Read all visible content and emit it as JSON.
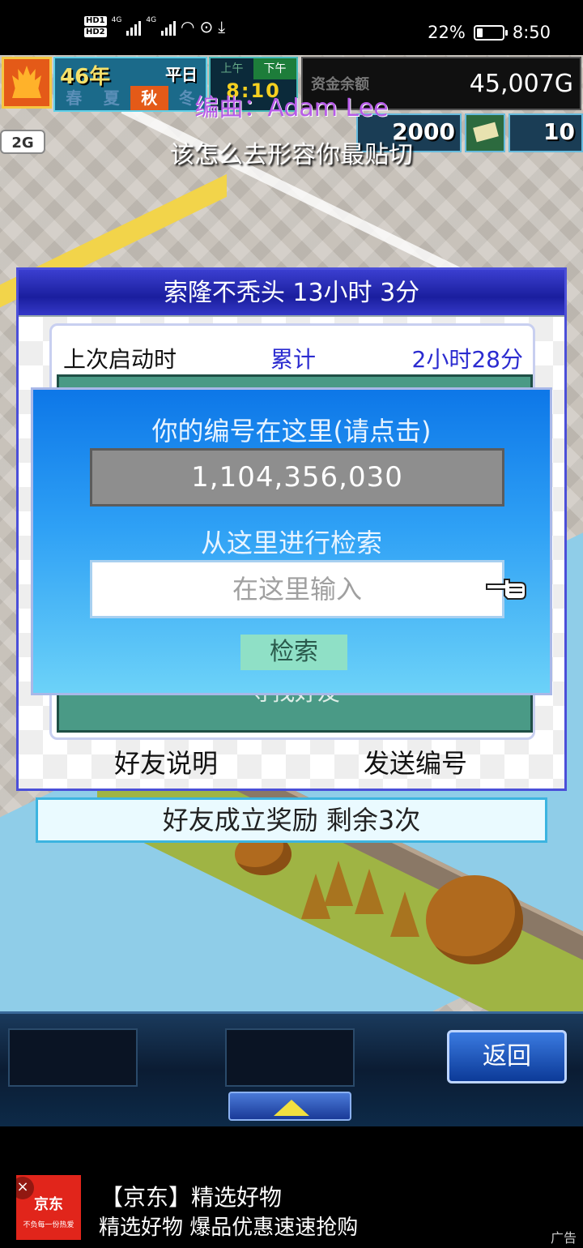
{
  "status_bar": {
    "hd1": "HD1",
    "hd2": "HD2",
    "net1": "4G",
    "net2": "4G",
    "battery": "22%",
    "battery_level": 0.22,
    "time": "8:50"
  },
  "hud": {
    "year": "46年",
    "day_type": "平日",
    "seasons": [
      "春",
      "夏",
      "秋",
      "冬"
    ],
    "active_season": "秋",
    "am": "上午",
    "pm": "下午",
    "clock": "8:10",
    "funds_label": "资金余额",
    "funds": "45,007G",
    "points": "2000",
    "ticket_count": "10",
    "level_badge": "2G"
  },
  "overlay": {
    "composer": "编曲：Adam Lee",
    "lyric": "该怎么去形容你最贴切"
  },
  "dialog": {
    "title": "索隆不秃头  13小时 3分",
    "last_launch": "上次启动时",
    "total_label": "累计",
    "total_value": "2小时28分",
    "find_friend": "寻找好友",
    "friend_desc": "好友说明",
    "send_code": "发送编号",
    "reward": "好友成立奖励  剩余3次"
  },
  "popup": {
    "title": "你的编号在这里(请点击)",
    "code": "1,104,356,030",
    "search_label": "从这里进行检索",
    "search_placeholder": "在这里输入",
    "search_button": "检索"
  },
  "gamebar": {
    "back": "返回"
  },
  "ad": {
    "logo": "京东",
    "logo_slogan": "不负每一份热爱",
    "title": "【京东】精选好物",
    "desc": "精选好物 爆品优惠速速抢购",
    "tag": "广告"
  }
}
